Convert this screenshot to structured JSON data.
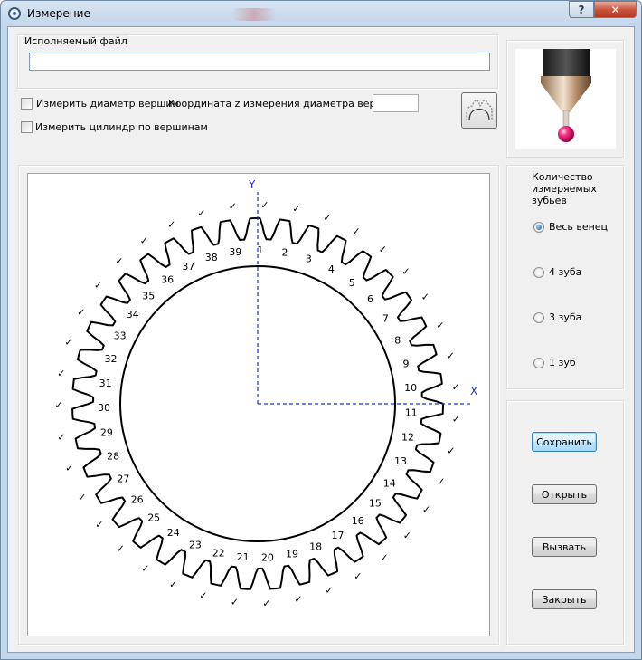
{
  "window": {
    "title": "Измерение",
    "help_label": "?",
    "close_label": "✕"
  },
  "file": {
    "group_label": "Исполняемый файл",
    "value": ""
  },
  "options": {
    "measure_tip_diameter": {
      "label": "Измерить диаметр вершин",
      "checked": false
    },
    "z_coordinate_label": "Координата z измерения диаметра вершин",
    "z_coordinate_value": "",
    "measure_tip_cylinder": {
      "label": "Измерить цилиндр по вершинам",
      "checked": false
    }
  },
  "probe": {
    "icon": "probe-stylus-image"
  },
  "gear": {
    "teeth": 39,
    "axis_x_label": "X",
    "axis_y_label": "Y",
    "check_mark": "✓",
    "tooth_labels": [
      "1",
      "2",
      "3",
      "4",
      "5",
      "6",
      "7",
      "8",
      "9",
      "10",
      "11",
      "12",
      "13",
      "14",
      "15",
      "16",
      "17",
      "18",
      "19",
      "20",
      "21",
      "22",
      "23",
      "24",
      "25",
      "26",
      "27",
      "28",
      "29",
      "30",
      "31",
      "32",
      "33",
      "34",
      "35",
      "36",
      "37",
      "38",
      "39"
    ],
    "axis_color": "#1f2fd6"
  },
  "teeth_group": {
    "title": "Количество измеряемых зубьев",
    "options": [
      {
        "label": "Весь венец",
        "checked": true
      },
      {
        "label": "4 зуба",
        "checked": false
      },
      {
        "label": "3 зуба",
        "checked": false
      },
      {
        "label": "1 зуб",
        "checked": false
      }
    ]
  },
  "actions": {
    "save": "Сохранить",
    "open": "Открыть",
    "call": "Вызвать",
    "close": "Закрыть"
  }
}
